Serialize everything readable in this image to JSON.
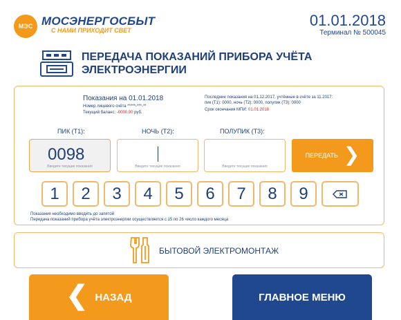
{
  "header": {
    "logo_text": "МЭС",
    "brand": "МОСЭНЕРГОСБЫТ",
    "slogan": "С НАМИ ПРИХОДИТ СВЕТ",
    "date": "01.01.2018",
    "terminal": "Терминал № 500045"
  },
  "title": "ПЕРЕДАЧА ПОКАЗАНИЙ ПРИБОРА УЧЁТА ЭЛЕКТРОЭНЕРГИИ",
  "info": {
    "readings_date": "Показания на 01.01.2018",
    "account": "Номер лицевого счёта *****-***-**",
    "balance_label": "Текущий баланс: ",
    "balance_value": "-0000,00",
    "balance_unit": " руб.",
    "last_readings_line1": "Последние показания на 01.12.2017, учтённые в счёте за 11.2017:",
    "last_readings_line2": "пик (Т1): 0000, ночь (Т2): 0000, полупик (Т3): 0000",
    "mpi_label": "Срок окончания МПИ: ",
    "mpi_date": "01.01.2018"
  },
  "inputs": [
    {
      "label": "ПИК (Т1):",
      "value": "0098",
      "hint": "Введите текущие показания"
    },
    {
      "label": "НОЧЬ (Т2):",
      "value": "",
      "hint": "Введите текущие показания"
    },
    {
      "label": "ПОЛУПИК (Т3):",
      "value": "",
      "hint": "Введите текущие показания"
    }
  ],
  "send_button": "ПЕРЕДАТЬ",
  "keypad": [
    "1",
    "2",
    "3",
    "4",
    "5",
    "6",
    "7",
    "8",
    "9"
  ],
  "notes": {
    "line1": "Показания необходимо вводить до запятой",
    "line2": "Передача показаний прибора учёта электроэнергии осуществляется с 15 по 26 число каждого месяца"
  },
  "service": {
    "label": "БЫТОВОЙ ЭЛЕКТРОМОНТАЖ",
    "icon": "tools-icon"
  },
  "nav": {
    "back": "НАЗАД",
    "main_menu": "ГЛАВНОЕ МЕНЮ"
  },
  "colors": {
    "orange": "#f39a1c",
    "navy": "#20488f",
    "red": "#d2232a"
  }
}
